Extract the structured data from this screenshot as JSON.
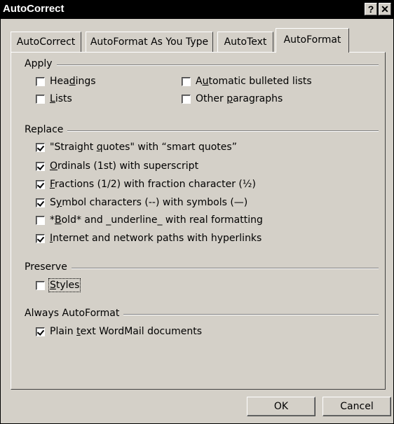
{
  "window": {
    "title": "AutoCorrect",
    "help_glyph": "?",
    "close_glyph": "✕"
  },
  "tabs": [
    {
      "label": "AutoCorrect",
      "active": false
    },
    {
      "label": "AutoFormat As You Type",
      "active": false
    },
    {
      "label": "AutoText",
      "active": false
    },
    {
      "label": "AutoFormat",
      "active": true
    }
  ],
  "groups": {
    "apply": {
      "label": "Apply",
      "items": [
        {
          "pre": "Hea",
          "key": "d",
          "post": "ings",
          "checked": false
        },
        {
          "pre": "A",
          "key": "u",
          "post": "tomatic bulleted lists",
          "checked": false
        },
        {
          "pre": "",
          "key": "L",
          "post": "ists",
          "checked": false
        },
        {
          "pre": "Other ",
          "key": "p",
          "post": "aragraphs",
          "checked": false
        }
      ]
    },
    "replace": {
      "label": "Replace",
      "items": [
        {
          "pre": "\"Straight ",
          "key": "q",
          "post": "uotes\" with “smart quotes”",
          "checked": true
        },
        {
          "pre": "",
          "key": "O",
          "post": "rdinals (1st) with superscript",
          "checked": true
        },
        {
          "pre": "",
          "key": "F",
          "post": "ractions (1/2) with fraction character (½)",
          "checked": true
        },
        {
          "pre": "S",
          "key": "y",
          "post": "mbol characters (--) with symbols (—)",
          "checked": true
        },
        {
          "pre": "*",
          "key": "B",
          "post": "old* and _underline_ with real formatting",
          "checked": false
        },
        {
          "pre": "",
          "key": "I",
          "post": "nternet and network paths with hyperlinks",
          "checked": true
        }
      ]
    },
    "preserve": {
      "label": "Preserve",
      "items": [
        {
          "pre": "",
          "key": "S",
          "post": "tyles",
          "checked": false
        }
      ]
    },
    "always": {
      "label": "Always AutoFormat",
      "items": [
        {
          "pre": "Plain ",
          "key": "t",
          "post": "ext WordMail documents",
          "checked": true
        }
      ]
    }
  },
  "buttons": {
    "ok": "OK",
    "cancel": "Cancel"
  }
}
